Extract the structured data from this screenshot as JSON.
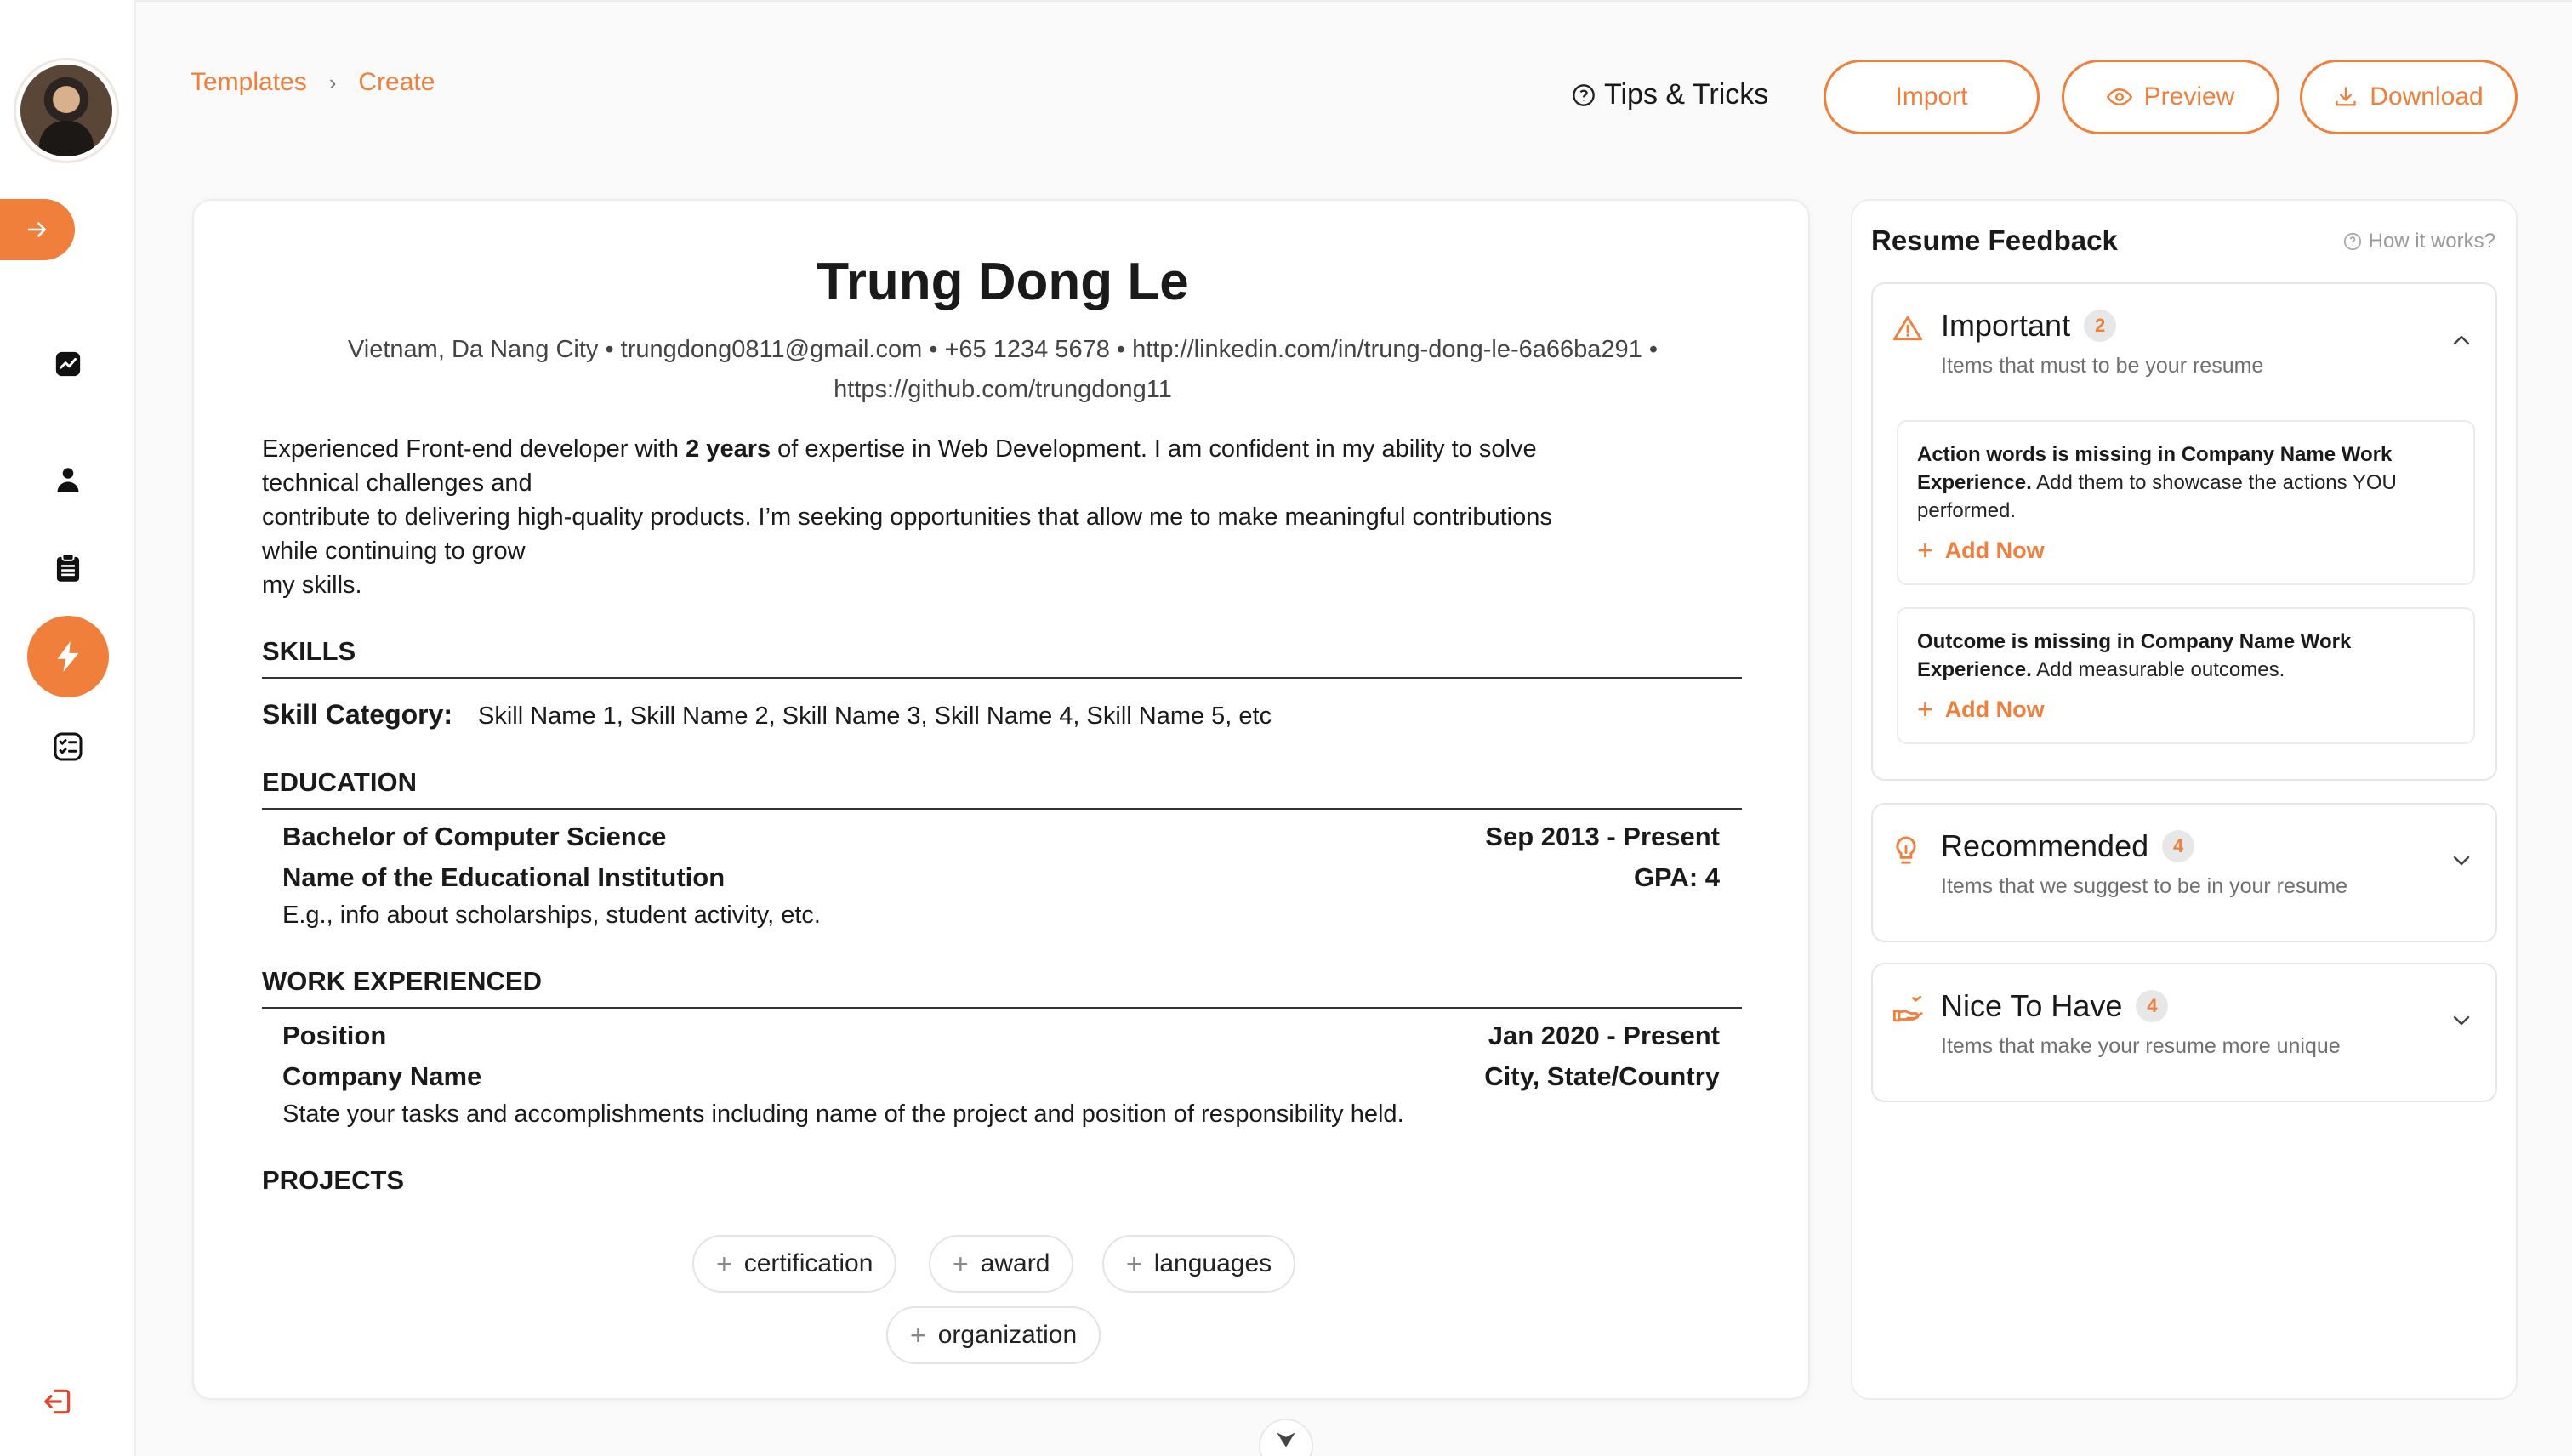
{
  "breadcrumb": {
    "item1": "Templates",
    "item2": "Create"
  },
  "toolbar": {
    "tips_label": "Tips & Tricks",
    "import_label": "Import",
    "preview_label": "Preview",
    "download_label": "Download"
  },
  "sidebar": {
    "items": [
      {
        "icon": "chart-icon"
      },
      {
        "icon": "user-icon"
      },
      {
        "icon": "clipboard-icon"
      },
      {
        "icon": "bolt-icon",
        "active": true
      },
      {
        "icon": "checklist-icon"
      },
      {
        "icon": "logout-icon"
      }
    ]
  },
  "resume": {
    "name": "Trung Dong Le",
    "contact_line1": "Vietnam, Da Nang City • trungdong0811@gmail.com • +65 1234 5678 • http://linkedin.com/in/trung-dong-le-6a66ba291 •",
    "contact_line2": "https://github.com/trungdong11",
    "summary": {
      "pre": "Experienced Front-end developer with ",
      "bold": "2 years",
      "post": " of expertise in Web Development. I am confident in my ability to solve",
      "line2": "technical challenges and",
      "line3": "contribute to delivering high-quality products. I’m seeking opportunities that allow me to make meaningful contributions",
      "line4": "while continuing to grow",
      "line5": "my skills."
    },
    "skills": {
      "heading": "SKILLS",
      "category": "Skill Category:",
      "items": "Skill Name 1, Skill Name 2, Skill Name 3, Skill Name 4, Skill Name 5, etc"
    },
    "education": {
      "heading": "EDUCATION",
      "degree": "Bachelor of Computer Science",
      "dates": "Sep 2013 - Present",
      "institution": "Name of the Educational Institution",
      "gpa": "GPA: 4",
      "info": "E.g., info about scholarships, student activity, etc."
    },
    "work": {
      "heading": "WORK EXPERIENCED",
      "position": "Position",
      "dates": "Jan 2020 - Present",
      "company": "Company Name",
      "location": "City, State/Country",
      "desc": "State your tasks and accomplishments including name of the project and position of responsibility held."
    },
    "projects": {
      "heading": "PROJECTS"
    },
    "add_sections": [
      "certification",
      "award",
      "languages",
      "organization"
    ]
  },
  "feedback": {
    "title": "Resume Feedback",
    "how_label": "How it works?",
    "important": {
      "title": "Important",
      "count": "2",
      "subtitle": "Items that must to be your resume",
      "issues": [
        {
          "bold": "Action words is missing in Company Name Work Experience.",
          "text": " Add them to showcase the actions YOU performed.",
          "action": "Add Now"
        },
        {
          "bold": "Outcome is missing in Company Name Work Experience.",
          "text": " Add measurable outcomes.",
          "action": "Add Now"
        }
      ]
    },
    "recommended": {
      "title": "Recommended",
      "count": "4",
      "subtitle": "Items that we suggest to be in your resume"
    },
    "nice": {
      "title": "Nice To Have",
      "count": "4",
      "subtitle": "Items that make your resume more unique"
    }
  },
  "colors": {
    "accent": "#f07f3c",
    "text": "#1a1a1a",
    "muted": "#707070"
  }
}
